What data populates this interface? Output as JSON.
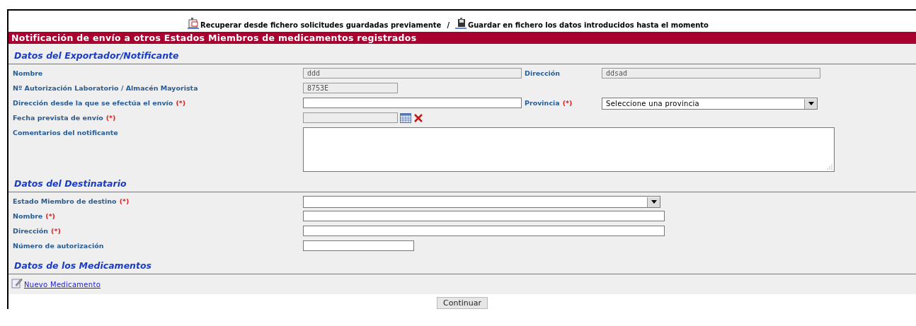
{
  "top_links": [
    {
      "kind": "recover",
      "text": "Recuperar desde fichero solicitudes guardadas previamente"
    },
    {
      "kind": "save",
      "text": "Guardar en fichero los datos introducidos hasta el momento"
    }
  ],
  "link_separator": "/",
  "title": "Notificación de envío a otros Estados Miembros de medicamentos registrados",
  "sections": [
    {
      "heading": "Datos del Exportador/Notificante",
      "rows": [
        [
          {
            "label": "Nombre",
            "required": false,
            "kind": "text",
            "value": "ddd",
            "disabled": true
          },
          {
            "label": "Dirección",
            "required": false,
            "kind": "text",
            "value": "ddsad",
            "disabled": true
          }
        ],
        [
          {
            "label": "Nº Autorización Laboratorio / Almacén Mayorista",
            "required": false,
            "kind": "text",
            "value": "8753E",
            "disabled": true
          }
        ],
        [
          {
            "label": "Dirección desde la que se efectúa el envío",
            "required": true,
            "kind": "text",
            "disabled": false
          },
          {
            "label": "Provincia",
            "required": true,
            "kind": "select",
            "value": "Seleccione una provincia",
            "disabled": false
          }
        ],
        [
          {
            "label": "Fecha prevista de envío",
            "required": true,
            "kind": "date",
            "disabled": true
          }
        ],
        [
          {
            "label": "Comentarios del notificante",
            "required": false,
            "kind": "textarea"
          }
        ]
      ]
    },
    {
      "heading": "Datos del Destinatario",
      "rows": [
        [
          {
            "label": "Estado Miembro de destino",
            "required": true,
            "kind": "select",
            "disabled": false
          }
        ],
        [
          {
            "label": "Nombre",
            "required": true,
            "kind": "text",
            "disabled": false
          }
        ],
        [
          {
            "label": "Dirección",
            "required": true,
            "kind": "text",
            "disabled": false
          }
        ],
        [
          {
            "label": "Número de autorización",
            "required": false,
            "kind": "text",
            "disabled": false
          }
        ]
      ]
    },
    {
      "heading": "Datos de los Medicamentos",
      "link": "Nuevo Medicamento"
    }
  ],
  "required_mark": "(*)",
  "continue_button": "Continuar"
}
